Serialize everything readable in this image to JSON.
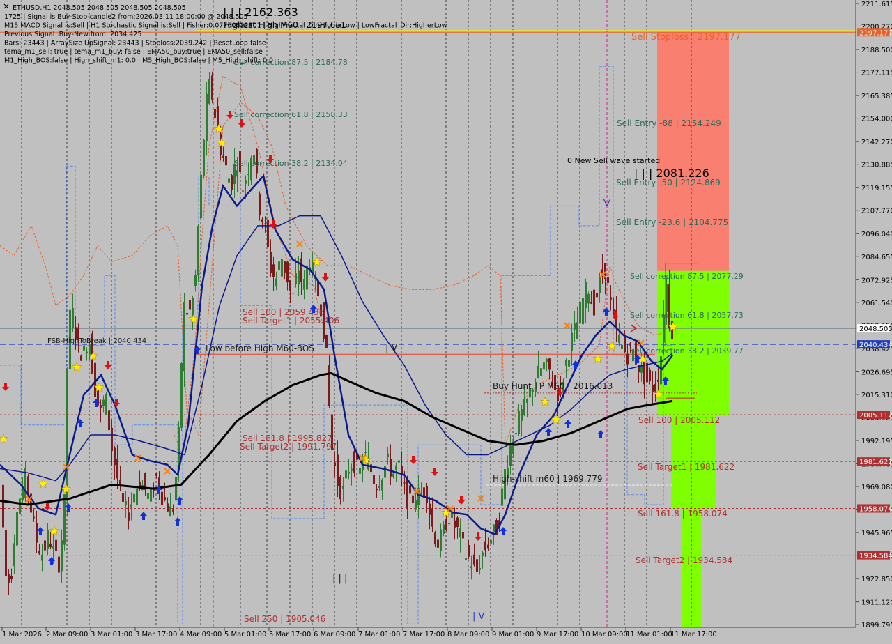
{
  "window": {
    "title": "ETHUSD,H1  2048.505 2048.505 2048.505 2048.505"
  },
  "info_lines": [
    "1725 | Signal is Buy-Stop-candle2 from:2026.03.11 18:00:00 @ 2048.505",
    "M15 MACD Signal is:Sell | H1 Stochastic Signal is:Sell | Fisher:0.07760622801 | HighFractal_Dir:HigherLow | LowFractal_Dir:HigherLow",
    "Previous Signal :Buy-New from: 2034.425",
    "Bars: 23443 | ArraySize UpSignal: 23443 | Stoploss:2039.242 | ResetLoop:false",
    "tema_m1_sell: true | tema_m1_buy: false | EMA50_buy:true | EMA50_sell:false",
    "M1_High_BOS:false | High_shift_m1: 0.0 | M5_High_BOS:false | M5_High_shift: 0.0"
  ],
  "top_labels": {
    "wave_count": "| | | 2162.363",
    "highest_high": "Highest High   M60 | 2197.651"
  },
  "chart_data": {
    "type": "candlestick",
    "symbol": "ETHUSD",
    "timeframe": "H1",
    "ylim": [
      1899.795,
      2211.615
    ],
    "y_ticks": [
      2211.615,
      2200.27,
      2188.5,
      2177.115,
      2165.385,
      2154.0,
      2142.27,
      2130.885,
      2119.155,
      2107.77,
      2096.04,
      2084.655,
      2072.925,
      2061.54,
      2050.155,
      2038.425,
      2026.695,
      2015.31,
      2003.925,
      1992.195,
      1980.465,
      1969.08,
      1957.35,
      1945.965,
      1934.58,
      1922.85,
      1911.12,
      1899.795
    ],
    "x_ticks": [
      "1 Mar 2026",
      "2 Mar 09:00",
      "3 Mar 01:00",
      "3 Mar 17:00",
      "4 Mar 09:00",
      "5 Mar 01:00",
      "5 Mar 17:00",
      "6 Mar 09:00",
      "7 Mar 01:00",
      "7 Mar 17:00",
      "8 Mar 09:00",
      "9 Mar 01:00",
      "9 Mar 17:00",
      "10 Mar 09:00",
      "11 Mar 01:00",
      "11 Mar 17:00"
    ],
    "price_path": [
      [
        0,
        1985
      ],
      [
        5,
        1960
      ],
      [
        12,
        1918
      ],
      [
        20,
        1928
      ],
      [
        26,
        1960
      ],
      [
        33,
        1965
      ],
      [
        40,
        1975
      ],
      [
        48,
        1955
      ],
      [
        56,
        1940
      ],
      [
        64,
        1935
      ],
      [
        72,
        1945
      ],
      [
        80,
        1935
      ],
      [
        88,
        1930
      ],
      [
        96,
        1965
      ],
      [
        100,
        2050
      ],
      [
        106,
        2058
      ],
      [
        114,
        2040
      ],
      [
        122,
        2035
      ],
      [
        130,
        2045
      ],
      [
        138,
        2020
      ],
      [
        146,
        2005
      ],
      [
        154,
        2015
      ],
      [
        162,
        1990
      ],
      [
        170,
        1975
      ],
      [
        178,
        1960
      ],
      [
        186,
        1955
      ],
      [
        194,
        1965
      ],
      [
        202,
        1972
      ],
      [
        210,
        1968
      ],
      [
        218,
        1962
      ],
      [
        226,
        1975
      ],
      [
        234,
        1965
      ],
      [
        242,
        1960
      ],
      [
        250,
        1955
      ],
      [
        258,
        1985
      ],
      [
        266,
        2060
      ],
      [
        274,
        2055
      ],
      [
        282,
        2068
      ],
      [
        290,
        2118
      ],
      [
        298,
        2160
      ],
      [
        304,
        2172
      ],
      [
        310,
        2158
      ],
      [
        318,
        2140
      ],
      [
        326,
        2130
      ],
      [
        334,
        2120
      ],
      [
        342,
        2135
      ],
      [
        350,
        2118
      ],
      [
        358,
        2128
      ],
      [
        366,
        2142
      ],
      [
        374,
        2110
      ],
      [
        382,
        2100
      ],
      [
        390,
        2080
      ],
      [
        398,
        2072
      ],
      [
        406,
        2085
      ],
      [
        414,
        2075
      ],
      [
        422,
        2062
      ],
      [
        430,
        2080
      ],
      [
        438,
        2068
      ],
      [
        446,
        2085
      ],
      [
        454,
        2072
      ],
      [
        462,
        2062
      ],
      [
        470,
        2040
      ],
      [
        478,
        1990
      ],
      [
        486,
        1972
      ],
      [
        494,
        1965
      ],
      [
        502,
        1978
      ],
      [
        510,
        1982
      ],
      [
        518,
        1975
      ],
      [
        526,
        1985
      ],
      [
        534,
        1978
      ],
      [
        542,
        1970
      ],
      [
        550,
        1975
      ],
      [
        558,
        1982
      ],
      [
        566,
        1975
      ],
      [
        574,
        1980
      ],
      [
        582,
        1968
      ],
      [
        590,
        1960
      ],
      [
        598,
        1965
      ],
      [
        606,
        1965
      ],
      [
        614,
        1968
      ],
      [
        622,
        1950
      ],
      [
        630,
        1940
      ],
      [
        638,
        1945
      ],
      [
        646,
        1955
      ],
      [
        654,
        1950
      ],
      [
        662,
        1945
      ],
      [
        670,
        1935
      ],
      [
        678,
        1932
      ],
      [
        686,
        1925
      ],
      [
        694,
        1935
      ],
      [
        702,
        1940
      ],
      [
        710,
        1945
      ],
      [
        718,
        1950
      ],
      [
        726,
        1975
      ],
      [
        734,
        1988
      ],
      [
        742,
        1998
      ],
      [
        750,
        2005
      ],
      [
        758,
        2010
      ],
      [
        766,
        2020
      ],
      [
        774,
        2025
      ],
      [
        782,
        2030
      ],
      [
        790,
        2028
      ],
      [
        798,
        2018
      ],
      [
        806,
        2015
      ],
      [
        814,
        2030
      ],
      [
        822,
        2042
      ],
      [
        830,
        2050
      ],
      [
        838,
        2062
      ],
      [
        846,
        2070
      ],
      [
        854,
        2058
      ],
      [
        862,
        2070
      ],
      [
        870,
        2080
      ],
      [
        878,
        2062
      ],
      [
        886,
        2048
      ],
      [
        894,
        2040
      ],
      [
        902,
        2035
      ],
      [
        910,
        2038
      ],
      [
        918,
        2030
      ],
      [
        926,
        2025
      ],
      [
        934,
        2020
      ],
      [
        942,
        2018
      ],
      [
        950,
        2030
      ],
      [
        958,
        2075
      ],
      [
        964,
        2048
      ]
    ],
    "lines": [
      {
        "label": "2197.177",
        "price": 2197.177,
        "color": "#e8602a",
        "style": "solid"
      },
      {
        "label": "2048.505",
        "price": 2048.505,
        "color": "#6a7a8a",
        "style": "solid"
      },
      {
        "label": "2040.434",
        "price": 2040.434,
        "color": "#1f3fbf",
        "style": "dashed"
      },
      {
        "label": "2005.112",
        "price": 2005.112,
        "color": "#b03030",
        "style": "dotted"
      },
      {
        "label": "1981.622",
        "price": 1981.622,
        "color": "#b03030",
        "style": "dotted"
      },
      {
        "label": "1958.074",
        "price": 1958.074,
        "color": "#b03030",
        "style": "dotted"
      },
      {
        "label": "1934.584",
        "price": 1934.584,
        "color": "#b03030",
        "style": "dotted"
      }
    ],
    "annotations": [
      {
        "text": "Sell Stoploss | 2197.177",
        "price": 2197.177,
        "color": "#e8602a"
      },
      {
        "text": "Sell Entry -88 | 2154.249",
        "price": 2154.249,
        "color": "#2a6a5a"
      },
      {
        "text": "Sell Entry -50 | 2124.869",
        "price": 2124.869,
        "color": "#2a6a5a"
      },
      {
        "text": "Sell Entry -23.6 | 2104.775",
        "price": 2104.775,
        "color": "#2a6a5a"
      },
      {
        "text": "Sell correction 87.5 | 2077.29",
        "price": 2077.29,
        "color": "#2a6a5a"
      },
      {
        "text": "Sell correction 61.8 | 2057.73",
        "price": 2057.73,
        "color": "#2a6a5a"
      },
      {
        "text": "Sell correction 38.2 | 2039.77",
        "price": 2039.77,
        "color": "#2a6a5a"
      },
      {
        "text": "Sell 100 | 2005.112",
        "price": 2005.112,
        "color": "#b03030"
      },
      {
        "text": "Sell Target1 | 1981.622",
        "price": 1981.622,
        "color": "#b03030"
      },
      {
        "text": "Sell 161.8 | 1958.074",
        "price": 1958.074,
        "color": "#b03030"
      },
      {
        "text": "Sell Target2 | 1934.584",
        "price": 1934.584,
        "color": "#b03030"
      },
      {
        "text": "Sell correction 87.5 | 2184.78",
        "price": 2184.78,
        "color": "#2a6a5a"
      },
      {
        "text": "Sell correction 61.8 | 2158.33",
        "price": 2158.33,
        "color": "#2a6a5a"
      },
      {
        "text": "Sell correction 38.2 | 2134.04",
        "price": 2134.04,
        "color": "#2a6a5a"
      },
      {
        "text": "Sell 100 | 2059.436",
        "price": 2059.436,
        "color": "#b03030"
      },
      {
        "text": "Sell Target1 | 2055.406",
        "price": 2055.406,
        "color": "#b03030"
      },
      {
        "text": "Sell 161.8 | 1995.827",
        "price": 1995.827,
        "color": "#b03030"
      },
      {
        "text": "Sell Target2 | 1991.797",
        "price": 1991.797,
        "color": "#b03030"
      },
      {
        "text": "Sell  250 | 1905.046",
        "price": 1905.046,
        "color": "#b03030"
      },
      {
        "text": "FSB-HighToBreak | 2040.434",
        "price": 2040.434,
        "color": "#1a1a1a"
      },
      {
        "text": "Low before High   M60-BOS",
        "price": 2035.5,
        "color": "#1a1a1a"
      },
      {
        "text": "Buy Hunt  TP M60 | 2016.013",
        "price": 2016.013,
        "color": "#1a1a1a"
      },
      {
        "text": "High-shift m60 | 1969.779",
        "price": 1969.779,
        "color": "#1a1a1a"
      },
      {
        "text": "0 New Sell wave started",
        "price": 2131.5,
        "color": "#000000"
      },
      {
        "text": "| | | 2081.226",
        "price": 2123.0,
        "color": "#000000"
      },
      {
        "text": "| V",
        "price": 2038.0,
        "color": "#1a1a1a"
      },
      {
        "text": "| | |",
        "price": 1925.0,
        "color": "#1a1a1a"
      },
      {
        "text": "| V",
        "price": 1904.0,
        "color": "#1f3fbf"
      }
    ],
    "colors": {
      "background": "#c0c0c0",
      "bull_candle": "#2e7d32",
      "bear_candle": "#7a1a1a",
      "ma_blue": "#0b1a8a",
      "ma_black": "#000000",
      "stoploss_zone": "#f98070",
      "target_zone": "#80ff00",
      "orange_envelope": "#e8602a",
      "blue_step": "#5a8ae8"
    }
  }
}
